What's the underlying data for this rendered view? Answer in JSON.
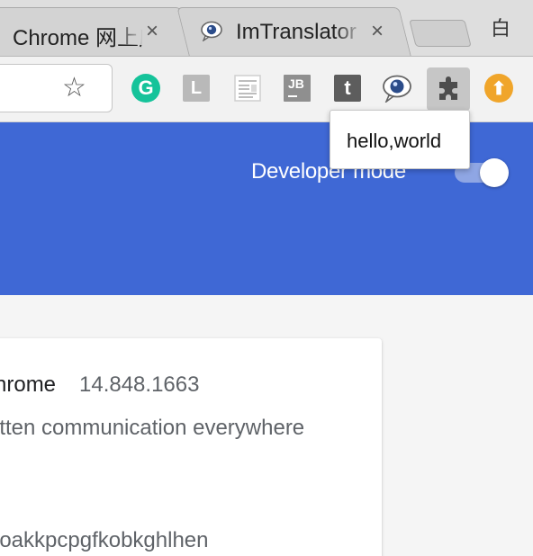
{
  "tabs": [
    {
      "title": "Chrome 网上应用店",
      "close": "×"
    },
    {
      "title": "ImTranslator",
      "close": "×"
    }
  ],
  "window": {
    "corner_char": "白"
  },
  "toolbar": {
    "bookmark_star": "☆",
    "extensions": [
      {
        "icon": "grammarly-icon",
        "glyph": "G"
      },
      {
        "icon": "l-extension-icon",
        "glyph": "L"
      },
      {
        "icon": "reader-icon",
        "glyph": ""
      },
      {
        "icon": "jb-icon",
        "glyph": "JB"
      },
      {
        "icon": "t-extension-icon",
        "glyph": "t"
      },
      {
        "icon": "imtranslator-icon",
        "glyph": ""
      },
      {
        "icon": "puzzle-extensions-icon",
        "glyph": ""
      },
      {
        "icon": "upload-icon",
        "glyph": "⬆"
      }
    ]
  },
  "tooltip": {
    "text": "hello,world"
  },
  "header": {
    "developer_mode_label": "Developer mode",
    "developer_mode_on": true,
    "accent_color": "#3f68d5"
  },
  "extension_card": {
    "name": "hrome",
    "version": "14.848.1663",
    "description": "itten communication everywhere",
    "id": "ioakkpcpgfkobkghlhen"
  }
}
